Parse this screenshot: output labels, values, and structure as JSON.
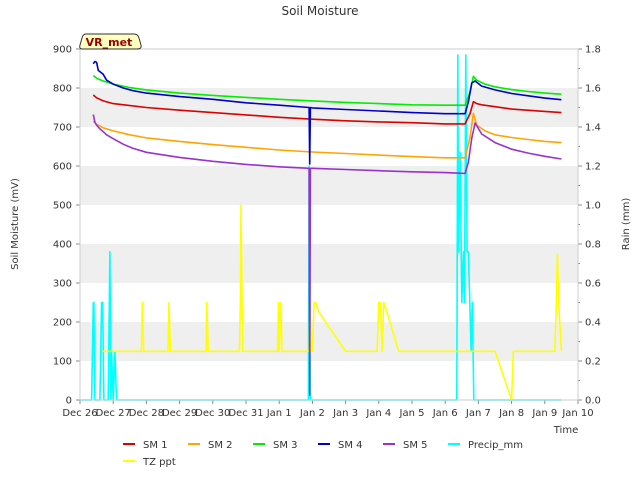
{
  "chart_data": {
    "type": "line",
    "title": "Soil Moisture",
    "xlabel": "Time",
    "ylabel": "Soil Moisture (mV)",
    "y2label": "Rain (mm)",
    "badge": "VR_met",
    "ylim": [
      0,
      900
    ],
    "y2lim": [
      0,
      1.8
    ],
    "yticks": [
      0,
      100,
      200,
      300,
      400,
      500,
      600,
      700,
      800,
      900
    ],
    "y2ticks": [
      0.0,
      0.2,
      0.4,
      0.6,
      0.8,
      1.0,
      1.2,
      1.4,
      1.6,
      1.8
    ],
    "xlim": [
      0,
      15
    ],
    "xticks": [
      {
        "x": 0,
        "label": "Dec 26"
      },
      {
        "x": 1,
        "label": "Dec 27"
      },
      {
        "x": 2,
        "label": "Dec 28"
      },
      {
        "x": 3,
        "label": "Dec 29"
      },
      {
        "x": 4,
        "label": "Dec 30"
      },
      {
        "x": 5,
        "label": "Dec 31"
      },
      {
        "x": 6,
        "label": "Jan 1"
      },
      {
        "x": 7,
        "label": "Jan 2"
      },
      {
        "x": 8,
        "label": "Jan 3"
      },
      {
        "x": 9,
        "label": "Jan 4"
      },
      {
        "x": 10,
        "label": "Jan 5"
      },
      {
        "x": 11,
        "label": "Jan 6"
      },
      {
        "x": 12,
        "label": "Jan 7"
      },
      {
        "x": 13,
        "label": "Jan 8"
      },
      {
        "x": 14,
        "label": "Jan 9"
      },
      {
        "x": 15,
        "label": "Jan 10"
      }
    ],
    "grid": "horizontal bands",
    "legend": "bottom",
    "series": [
      {
        "name": "SM 1",
        "color": "#dd0000",
        "axis": "left",
        "x": [
          0.4,
          0.5,
          0.7,
          1.0,
          2.0,
          3.0,
          4.0,
          5.0,
          6.0,
          7.0,
          8.0,
          9.0,
          10.0,
          11.0,
          11.6,
          11.75,
          11.85,
          11.95,
          12.1,
          12.5,
          13.0,
          14.0,
          14.5
        ],
        "y": [
          782,
          775,
          767,
          760,
          750,
          743,
          737,
          731,
          725,
          720,
          716,
          713,
          711,
          708,
          708,
          735,
          765,
          760,
          757,
          752,
          746,
          740,
          737
        ]
      },
      {
        "name": "SM 2",
        "color": "#ffa500",
        "axis": "left",
        "x": [
          0.4,
          0.5,
          0.7,
          1.0,
          1.5,
          2.0,
          3.0,
          4.0,
          5.0,
          6.0,
          7.0,
          8.0,
          9.0,
          10.0,
          11.0,
          11.6,
          11.75,
          11.85,
          11.95,
          12.2,
          12.5,
          13.0,
          13.5,
          14.0,
          14.5
        ],
        "y": [
          715,
          707,
          698,
          690,
          680,
          672,
          663,
          655,
          648,
          641,
          636,
          632,
          628,
          624,
          621,
          621,
          675,
          735,
          705,
          690,
          680,
          673,
          668,
          663,
          660
        ]
      },
      {
        "name": "SM 3",
        "color": "#00ee00",
        "axis": "left",
        "x": [
          0.4,
          0.5,
          0.7,
          1.0,
          1.5,
          2.0,
          3.0,
          4.0,
          5.0,
          6.0,
          7.0,
          8.0,
          9.0,
          10.0,
          11.0,
          11.6,
          11.75,
          11.85,
          11.95,
          12.2,
          12.5,
          13.0,
          13.5,
          14.0,
          14.5
        ],
        "y": [
          832,
          825,
          818,
          810,
          801,
          795,
          787,
          781,
          776,
          771,
          767,
          763,
          760,
          757,
          756,
          756,
          790,
          830,
          820,
          810,
          803,
          796,
          791,
          787,
          784
        ]
      },
      {
        "name": "SM 4",
        "color": "#0000cc",
        "axis": "left",
        "x": [
          0.4,
          0.45,
          0.5,
          0.55,
          0.7,
          0.8,
          1.0,
          1.3,
          1.6,
          2.0,
          3.0,
          4.0,
          5.0,
          6.0,
          6.9,
          6.92,
          6.94,
          7.0,
          8.0,
          9.0,
          10.0,
          11.0,
          11.6,
          11.7,
          11.8,
          11.9,
          12.1,
          12.5,
          13.0,
          13.5,
          14.0,
          14.5
        ],
        "y": [
          862,
          868,
          866,
          845,
          835,
          820,
          810,
          800,
          793,
          787,
          778,
          771,
          762,
          756,
          750,
          605,
          750,
          749,
          745,
          741,
          737,
          734,
          734,
          765,
          813,
          818,
          805,
          795,
          786,
          780,
          774,
          770
        ]
      },
      {
        "name": "SM 5",
        "color": "#9932cc",
        "axis": "left",
        "x": [
          0.4,
          0.45,
          0.5,
          0.6,
          0.7,
          0.8,
          1.0,
          1.3,
          1.6,
          2.0,
          3.0,
          4.0,
          5.0,
          6.0,
          6.9,
          6.92,
          6.94,
          7.0,
          8.0,
          9.0,
          10.0,
          11.0,
          11.6,
          11.7,
          11.8,
          11.9,
          12.1,
          12.5,
          13.0,
          13.5,
          14.0,
          14.5
        ],
        "y": [
          732,
          712,
          705,
          695,
          688,
          680,
          670,
          656,
          645,
          635,
          622,
          612,
          604,
          598,
          594,
          12,
          594,
          594,
          591,
          588,
          585,
          583,
          581,
          610,
          672,
          710,
          682,
          660,
          643,
          633,
          625,
          618
        ]
      },
      {
        "name": "Precip_mm",
        "color": "#00ffff",
        "axis": "right",
        "x": [
          0,
          0.35,
          0.4,
          0.42,
          0.45,
          0.6,
          0.65,
          0.68,
          0.72,
          0.85,
          0.9,
          0.93,
          0.95,
          1.0,
          1.05,
          1.1,
          6.88,
          6.9,
          6.92,
          6.94,
          11.3,
          11.35,
          11.38,
          11.4,
          11.45,
          11.5,
          11.55,
          11.58,
          11.62,
          11.66,
          11.7,
          11.74,
          11.78,
          11.82,
          11.86,
          11.9,
          14.5
        ],
        "y": [
          0,
          0,
          0.5,
          0.5,
          0,
          0,
          0.5,
          0.5,
          0,
          0,
          0.76,
          0,
          0.25,
          0,
          0.25,
          0,
          0,
          1.2,
          0.5,
          0,
          0,
          0,
          1.77,
          0.76,
          1.27,
          0.5,
          0.76,
          0.5,
          1.77,
          0.76,
          0.76,
          0.5,
          0.25,
          0.5,
          0,
          0,
          0
        ]
      },
      {
        "name": "TZ ppt",
        "color": "#ffff00",
        "axis": "right",
        "x": [
          0.65,
          0.75,
          1.0,
          1.85,
          1.88,
          1.92,
          2.65,
          2.68,
          2.72,
          3.8,
          3.82,
          3.86,
          4.8,
          4.83,
          4.85,
          4.88,
          4.9,
          4.95,
          5.0,
          5.95,
          5.98,
          6.0,
          6.05,
          6.08,
          6.12,
          6.9,
          6.93,
          6.96,
          7.0,
          7.05,
          7.1,
          7.2,
          7.6,
          8.0,
          8.5,
          8.7,
          8.95,
          9.0,
          9.05,
          9.1,
          9.15,
          9.25,
          9.6,
          10.0,
          11.0,
          11.5,
          12.0,
          12.5,
          12.8,
          13.0,
          13.05,
          13.5,
          14.0,
          14.3,
          14.35,
          14.38,
          14.42,
          14.5
        ],
        "y": [
          0.25,
          0.25,
          0.25,
          0.25,
          0.5,
          0.25,
          0.25,
          0.5,
          0.25,
          0.25,
          0.5,
          0.25,
          0.25,
          0.5,
          1.0,
          0.5,
          0.25,
          0.25,
          0.25,
          0.25,
          0.5,
          0.25,
          0.5,
          0.25,
          0.25,
          0.25,
          0.5,
          0.25,
          0.25,
          0.5,
          0.5,
          0.45,
          0.35,
          0.25,
          0.25,
          0.25,
          0.25,
          0.5,
          0.5,
          0.25,
          0.5,
          0.45,
          0.25,
          0.25,
          0.25,
          0.25,
          0.25,
          0.25,
          0.1,
          0.0,
          0.25,
          0.25,
          0.25,
          0.25,
          0.5,
          0.75,
          0.5,
          0.25
        ]
      }
    ]
  }
}
